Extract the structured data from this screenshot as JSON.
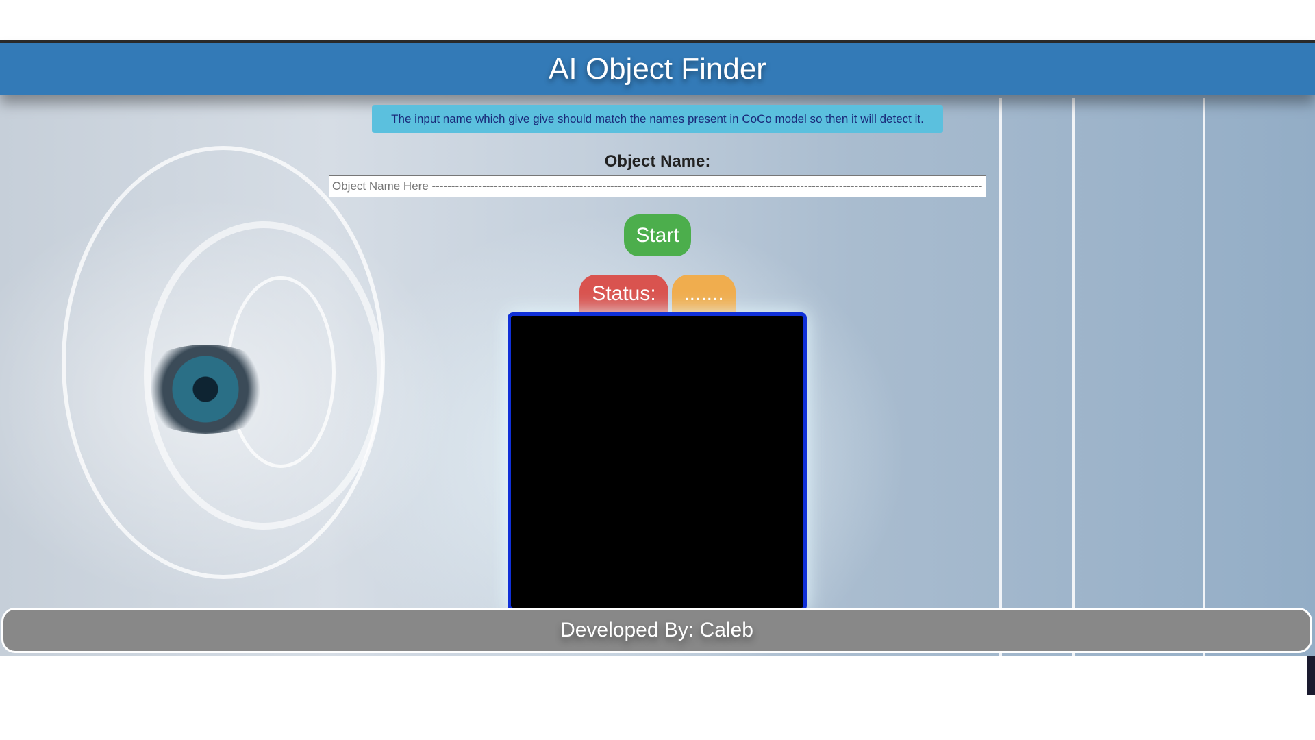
{
  "header": {
    "title": "AI Object Finder"
  },
  "info": {
    "message": "The input name which give give should match the names present in CoCo model so then it will detect it."
  },
  "form": {
    "object_label": "Object Name:",
    "object_placeholder": "Object Name Here -------------------------------------------------------------------------------------------------------------------------------------------------------------------------------------------",
    "object_value": "",
    "start_label": "Start"
  },
  "status": {
    "label": "Status:",
    "value": "......."
  },
  "footer": {
    "credit": "Developed By: Caleb"
  },
  "colors": {
    "header": "#337ab7",
    "info": "#5bc0de",
    "start": "#4cae4c",
    "status_label": "#d9534f",
    "status_value": "#f0ad4e",
    "video_border": "#1030d8",
    "footer": "#888888"
  }
}
